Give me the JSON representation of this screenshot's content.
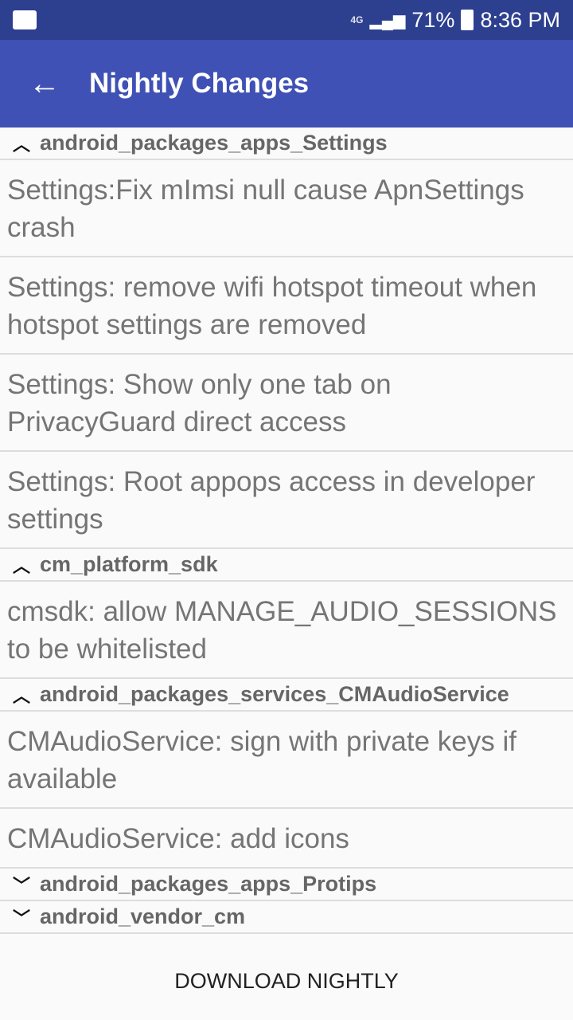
{
  "status_bar": {
    "network": "4G",
    "battery": "71%",
    "time": "8:36 PM"
  },
  "app_bar": {
    "title": "Nightly Changes"
  },
  "groups": [
    {
      "name": "android_packages_apps_Settings",
      "expanded": true,
      "items": [
        "Settings:Fix mImsi null cause ApnSettings crash",
        "Settings: remove wifi hotspot timeout when hotspot settings are removed",
        "Settings: Show only one tab on PrivacyGuard direct access",
        "Settings: Root appops access in developer settings"
      ]
    },
    {
      "name": "cm_platform_sdk",
      "expanded": true,
      "items": [
        "cmsdk: allow MANAGE_AUDIO_SESSIONS to be whitelisted"
      ]
    },
    {
      "name": "android_packages_services_CMAudioService",
      "expanded": true,
      "items": [
        "CMAudioService: sign with private keys if available",
        "CMAudioService: add icons"
      ]
    },
    {
      "name": "android_packages_apps_Protips",
      "expanded": false,
      "items": []
    },
    {
      "name": "android_vendor_cm",
      "expanded": false,
      "items": []
    }
  ],
  "download_button": "DOWNLOAD NIGHTLY"
}
